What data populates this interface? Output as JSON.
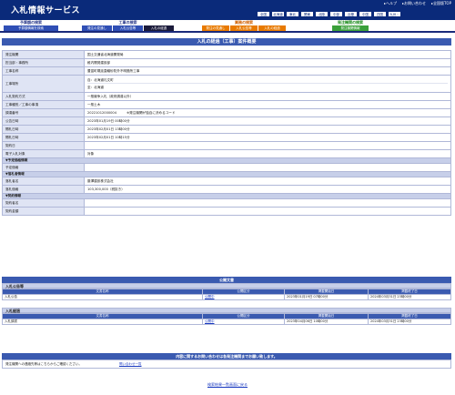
{
  "header": {
    "title": "入札情報サービス",
    "top_links": [
      "▸ヘルプ",
      "▸お問い合わせ",
      "▸全国版TOP"
    ],
    "areas": [
      "全国",
      "北海道",
      "東北",
      "関東",
      "北陸",
      "中部",
      "近畿",
      "中国",
      "四国",
      "九州・沖縄"
    ]
  },
  "nav": {
    "group1": {
      "title": "予算額の検索",
      "tabs": [
        "予算額情報を検索"
      ]
    },
    "group2": {
      "title": "工事の検索",
      "tabs": [
        "発注の見通し",
        "入札公告等",
        "入札の経過"
      ]
    },
    "group3": {
      "title": "業務の検索",
      "tabs": [
        "発注の見通し",
        "入札公告等",
        "入札の経過"
      ]
    },
    "group4": {
      "title": "発注機関の検索",
      "tabs": [
        "発注機関情報"
      ]
    }
  },
  "panel": {
    "heading": "入札の経過（工事）案件概要",
    "rows": [
      {
        "label": "発注機関",
        "value": "国土交通省北海道開発局"
      },
      {
        "label": "担当部・事務所",
        "value": "稚内開発建設部"
      },
      {
        "label": "工事名称",
        "value": "豊富町幌延直轄砂防外不明箇所工事"
      },
      {
        "label": "工事場所",
        "values": [
          "自：北海道礼文町",
          "至：北海道"
        ]
      },
      {
        "label": "入札契約方式",
        "value": "一般競争入札（政府調達以外）"
      },
      {
        "label": "工事種別／工事の事項",
        "value": "一般土木"
      },
      {
        "label": "調達番号",
        "value": "20221012000004",
        "note": "※発注機関が独自に決めるコード"
      },
      {
        "label": "公告日時",
        "value": "2023年01月19日 00時00分"
      },
      {
        "label": "開札日時",
        "value": "2023年02月01日 13時00分"
      },
      {
        "label": "開札日時",
        "value": "2023年02月01日 10時15分"
      },
      {
        "label": "契約日",
        "value": ""
      },
      {
        "label": "電子入札対象",
        "value": "対象"
      }
    ],
    "section_budget": "▼予定価格情報",
    "budget_rows": [
      {
        "label": "予定価格",
        "value": ""
      }
    ],
    "section_winner": "▼落札者情報",
    "winner_rows": [
      {
        "label": "落札者名",
        "value": "藤澤建設株式会社"
      },
      {
        "label": "落札価格",
        "value": "103,300,000（税抜き）"
      }
    ],
    "section_contract": "▼契約情報",
    "contract_rows": [
      {
        "label": "契約者名",
        "value": ""
      },
      {
        "label": "契約金額",
        "value": ""
      }
    ]
  },
  "documents": {
    "heading": "公開文書",
    "columns": [
      "文書名称",
      "公開区分",
      "掲載開始日",
      "掲載終了日"
    ],
    "sections": [
      {
        "title": "入札公告等",
        "rows": [
          {
            "name": "入札公告",
            "type": "公開中",
            "start": "2023年01月19日 07時00分",
            "end": "2024年03月31日 23時00分"
          }
        ]
      },
      {
        "title": "入札経過",
        "rows": [
          {
            "name": "入札調書",
            "type": "公開中",
            "start": "2023年04月06日 10時00分",
            "end": "2024年03月31日 23時00分"
          }
        ]
      }
    ]
  },
  "inquiry": {
    "heading": "内容に関するお問い合わせは各発注機関までお願い致します。",
    "text": "発注機関への連絡先等はこちらからご確認ください。",
    "link": "問い合わせ一覧"
  },
  "back_link": "検索結果一覧画面に戻る",
  "colors": {
    "header": "#0a2a7a",
    "panel_head": "#3a5ab0",
    "label_bg": "#dfe4f4",
    "section_bg": "#c7cfe9"
  }
}
